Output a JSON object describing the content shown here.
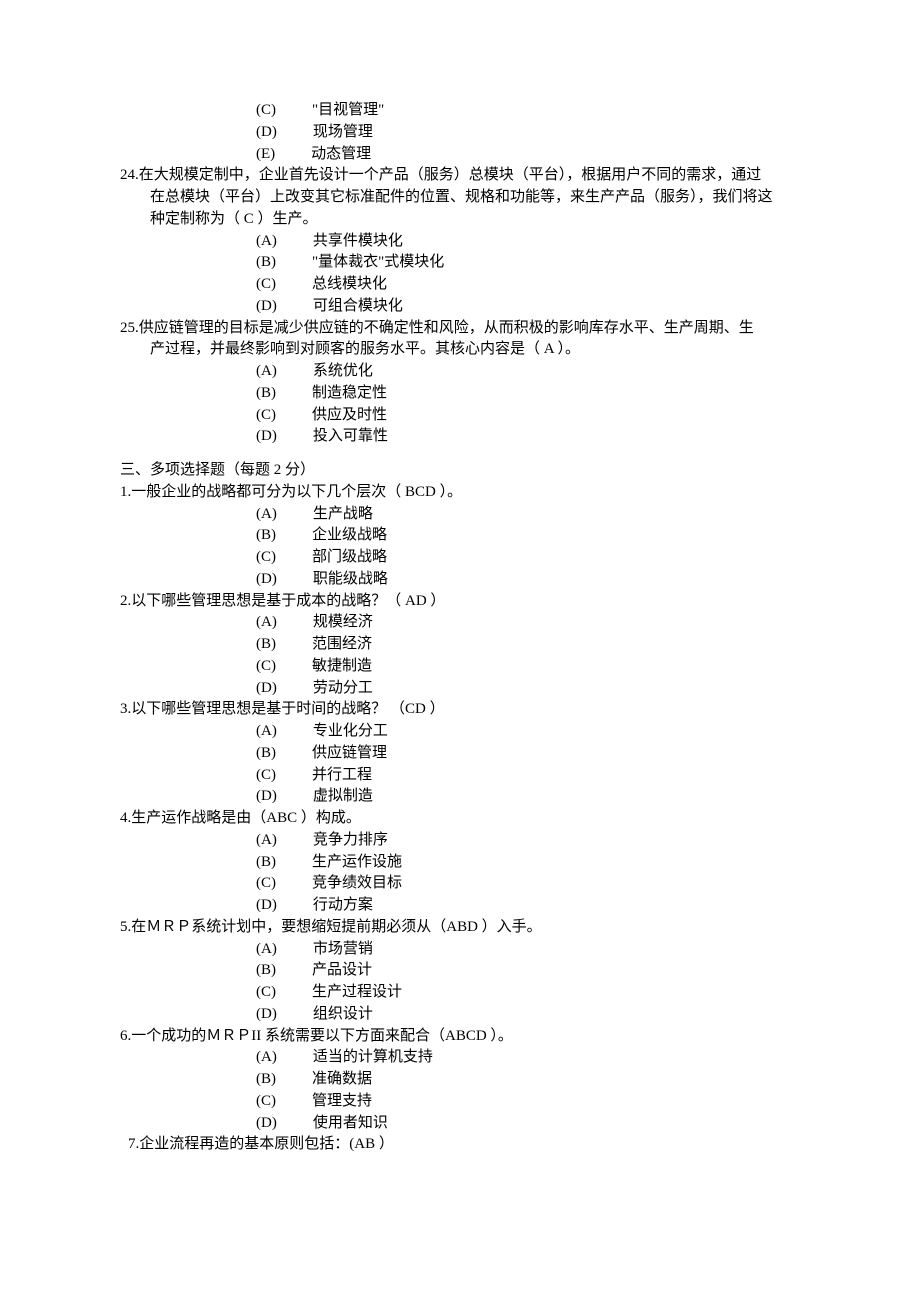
{
  "q23_tail_options": [
    {
      "letter": "(C)",
      "text": "\"目视管理\""
    },
    {
      "letter": "(D)",
      "text": "现场管理"
    },
    {
      "letter": "(E)",
      "text": "动态管理"
    }
  ],
  "q24": {
    "num": "24.",
    "line1": "在大规模定制中，企业首先设计一个产品（服务）总模块（平台），根据用户不同的需求，通过",
    "line2": "在总模块（平台）上改变其它标准配件的位置、规格和功能等，来生产产品（服务），我们将这",
    "line3": "种定制称为（  C  ）生产。",
    "options": [
      {
        "letter": "(A)",
        "text": "共享件模块化"
      },
      {
        "letter": "(B)",
        "text": "\"量体裁衣\"式模块化"
      },
      {
        "letter": "(C)",
        "text": "总线模块化"
      },
      {
        "letter": "(D)",
        "text": "可组合模块化"
      }
    ]
  },
  "q25": {
    "num": "25.",
    "line1": "供应链管理的目标是减少供应链的不确定性和风险，从而积极的影响库存水平、生产周期、生",
    "line2": "产过程，并最终影响到对顾客的服务水平。其核心内容是（  A   ）。",
    "options": [
      {
        "letter": "(A)",
        "text": "系统优化"
      },
      {
        "letter": "(B)",
        "text": "制造稳定性"
      },
      {
        "letter": "(C)",
        "text": "供应及时性"
      },
      {
        "letter": "(D)",
        "text": "投入可靠性"
      }
    ]
  },
  "section3_title": "三、多项选择题（每题 2 分）",
  "mq": [
    {
      "num": "1.",
      "stem": "一般企业的战略都可分为以下几个层次（ BCD   ）。",
      "options": [
        {
          "letter": "(A)",
          "text": "生产战略"
        },
        {
          "letter": "(B)",
          "text": "企业级战略"
        },
        {
          "letter": "(C)",
          "text": "部门级战略"
        },
        {
          "letter": "(D)",
          "text": "职能级战略"
        }
      ]
    },
    {
      "num": "2.",
      "stem": "以下哪些管理思想是基于成本的战略？（ AD    ）",
      "options": [
        {
          "letter": "(A)",
          "text": "规模经济"
        },
        {
          "letter": "(B)",
          "text": "范围经济"
        },
        {
          "letter": "(C)",
          "text": "敏捷制造"
        },
        {
          "letter": "(D)",
          "text": "劳动分工"
        }
      ]
    },
    {
      "num": "3.",
      "stem": "以下哪些管理思想是基于时间的战略？ （CD     ）",
      "options": [
        {
          "letter": "(A)",
          "text": "专业化分工"
        },
        {
          "letter": "(B)",
          "text": "供应链管理"
        },
        {
          "letter": "(C)",
          "text": "并行工程"
        },
        {
          "letter": "(D)",
          "text": "虚拟制造"
        }
      ]
    },
    {
      "num": "4.",
      "stem": "生产运作战略是由（ABC    ）构成。",
      "options": [
        {
          "letter": "(A)",
          "text": "竞争力排序"
        },
        {
          "letter": "(B)",
          "text": "生产运作设施"
        },
        {
          "letter": "(C)",
          "text": "竞争绩效目标"
        },
        {
          "letter": "(D)",
          "text": "行动方案"
        }
      ]
    },
    {
      "num": "5.",
      "stem": "在ＭＲＰ系统计划中，要想缩短提前期必须从（ABD    ）入手。",
      "options": [
        {
          "letter": "(A)",
          "text": "市场营销"
        },
        {
          "letter": "(B)",
          "text": "产品设计"
        },
        {
          "letter": "(C)",
          "text": "生产过程设计"
        },
        {
          "letter": "(D)",
          "text": "组织设计"
        }
      ]
    },
    {
      "num": "6.",
      "stem": "一个成功的ＭＲＰII 系统需要以下方面来配合（ABCD     ）。",
      "options": [
        {
          "letter": "(A)",
          "text": "适当的计算机支持"
        },
        {
          "letter": "(B)",
          "text": "准确数据"
        },
        {
          "letter": "(C)",
          "text": "管理支持"
        },
        {
          "letter": "(D)",
          "text": "使用者知识"
        }
      ]
    }
  ],
  "q7_partial": {
    "num": "7.",
    "stem": "企业流程再造的基本原则包括：(AB    ）"
  }
}
